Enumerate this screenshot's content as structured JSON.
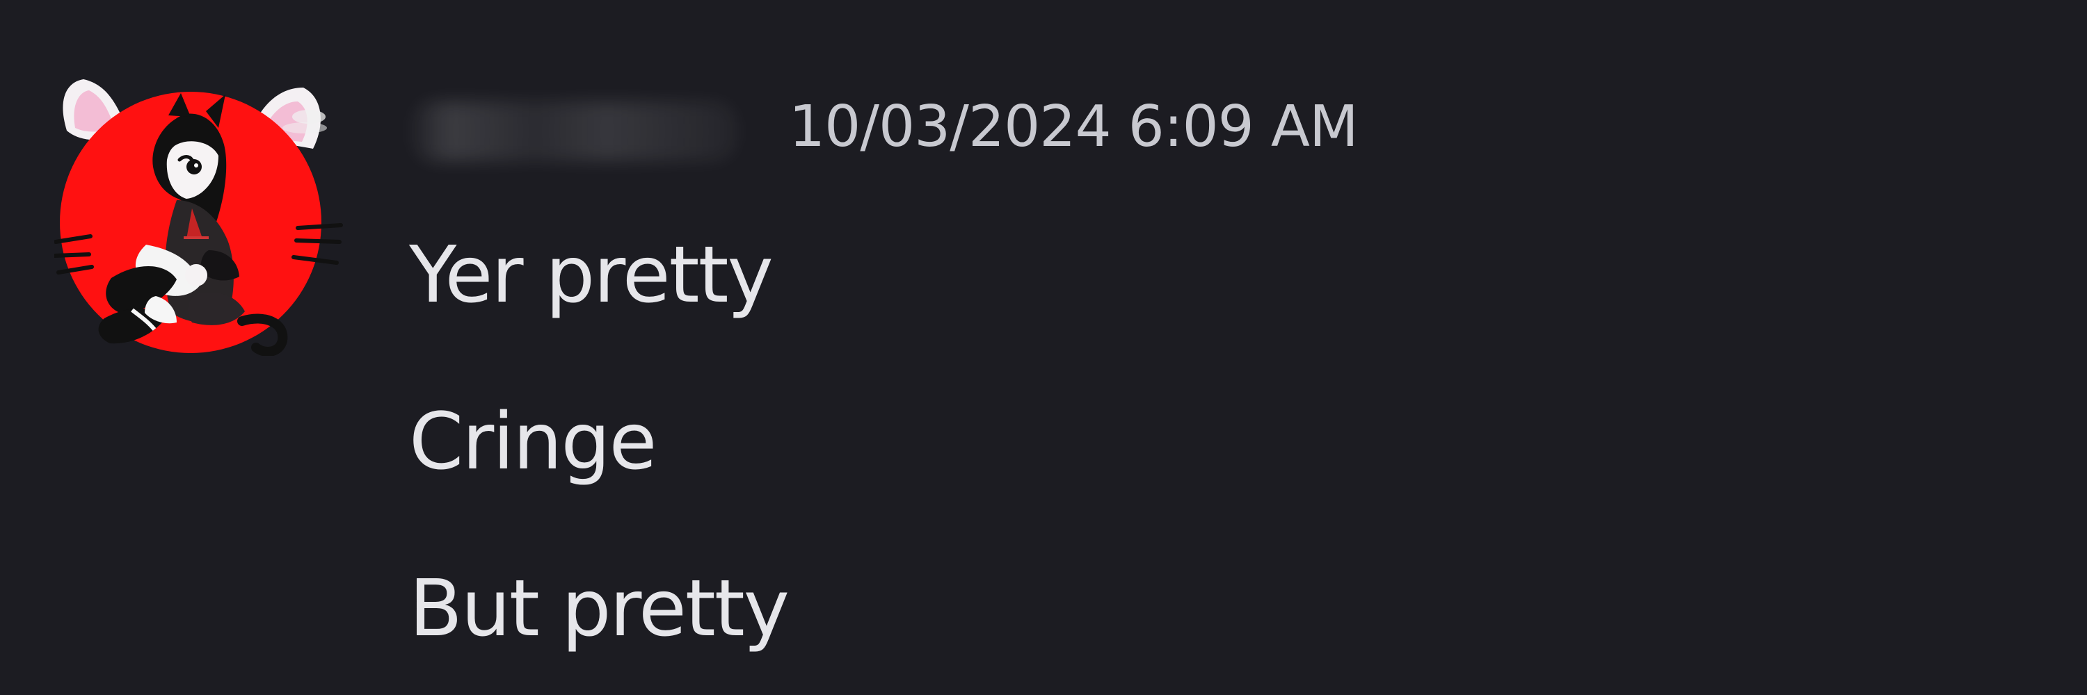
{
  "message": {
    "timestamp": "10/03/2024 6:09 AM",
    "lines": [
      "Yer pretty",
      "Cringe",
      "But pretty"
    ],
    "avatar_icon": "cat-girl-avatar-icon",
    "username_state": "redacted"
  },
  "colors": {
    "background": "#1c1c22",
    "message_text": "#e6e6ea",
    "timestamp_text": "#c8c9d0",
    "avatar_red": "#ff1111",
    "avatar_ear_pink": "#f3bdd5"
  }
}
